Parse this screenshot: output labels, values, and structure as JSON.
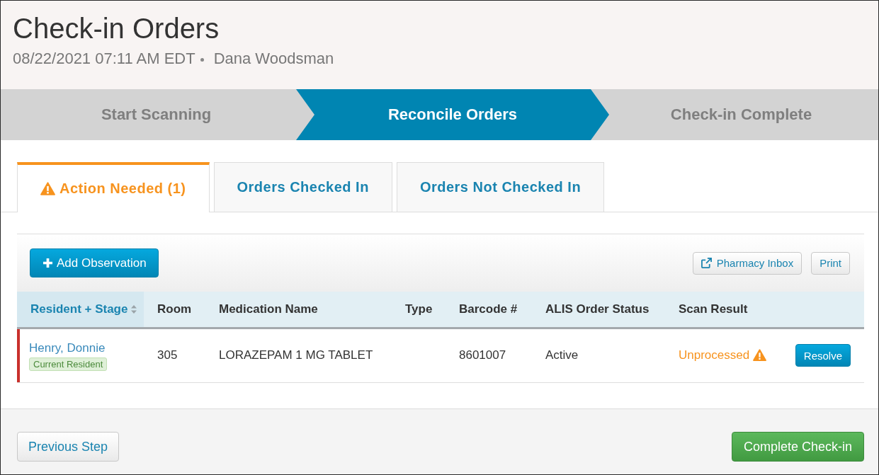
{
  "header": {
    "title": "Check-in Orders",
    "datetime": "08/22/2021 07:11 AM EDT",
    "user": "Dana Woodsman"
  },
  "steps": [
    {
      "label": "Start Scanning",
      "active": false
    },
    {
      "label": "Reconcile Orders",
      "active": true
    },
    {
      "label": "Check-in Complete",
      "active": false
    }
  ],
  "tabs": [
    {
      "label": "Action Needed (1)",
      "selected": true,
      "warning": true
    },
    {
      "label": "Orders Checked In",
      "selected": false,
      "warning": false
    },
    {
      "label": "Orders Not Checked In",
      "selected": false,
      "warning": false
    }
  ],
  "toolbar": {
    "add_button": "Add Observation",
    "buttons": [
      {
        "label": "Pharmacy Inbox",
        "kind": "external"
      },
      {
        "label": "Print",
        "kind": "plain"
      }
    ]
  },
  "table": {
    "columns": [
      {
        "label": "Resident + Stage",
        "sorted": true
      },
      {
        "label": "Room",
        "sorted": false
      },
      {
        "label": "Medication Name",
        "sorted": false
      },
      {
        "label": "Type",
        "sorted": false
      },
      {
        "label": "Barcode #",
        "sorted": false
      },
      {
        "label": "ALIS Order Status",
        "sorted": false
      },
      {
        "label": "Scan Result",
        "sorted": false
      }
    ],
    "rows": [
      {
        "flagged": true,
        "resident": "Henry, Donnie",
        "stage": "Current Resident",
        "room": "305",
        "medication": "LORAZEPAM 1 MG TABLET",
        "barcode": "8601007",
        "order_status": "Active",
        "scan_result": "Unprocessed",
        "scan_warning": true,
        "action": "Resolve"
      }
    ]
  },
  "footer": {
    "back_button": "Previous Step",
    "next_button": "Complete Check-in"
  }
}
